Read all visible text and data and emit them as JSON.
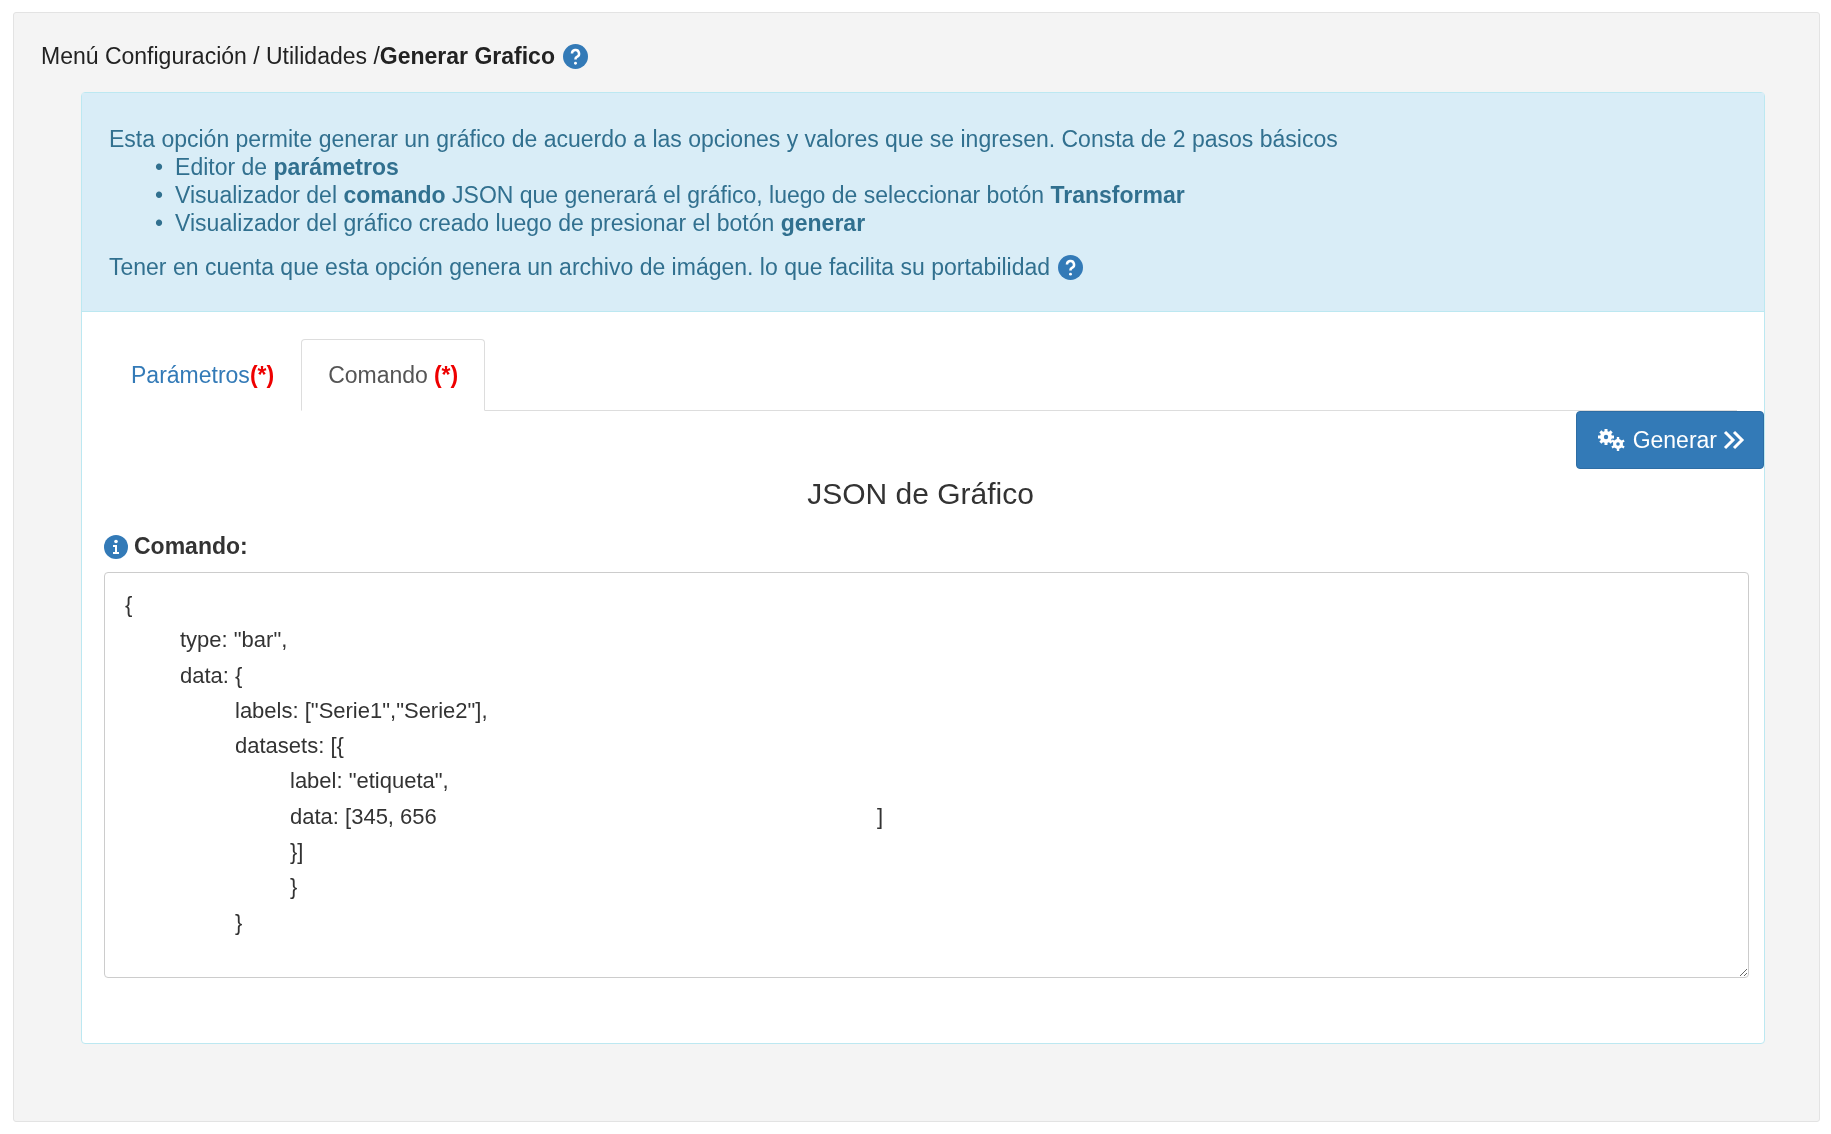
{
  "breadcrumb": {
    "text": "Menú Configuración / Utilidades /**Generar Grafico**"
  },
  "info": {
    "intro": "Esta opción permite generar un gráfico de acuerdo a las opciones y valores que se ingresen. Consta de 2 pasos básicos",
    "steps": [
      {
        "marker": "•",
        "text": "Editor de **parámetros**"
      },
      {
        "marker": "•",
        "text": "Visualizador del **comando** JSON que generará el gráfico, luego de seleccionar botón **Transformar**"
      },
      {
        "marker": "•",
        "text": "Visualizador del gráfico creado luego de presionar el botón **generar**"
      }
    ],
    "note": "Tener en cuenta que esta opción genera un archivo de imágen. lo que facilita su portabilidad"
  },
  "tabs": [
    {
      "label": "Parámetros",
      "required": "(*)",
      "selected": false
    },
    {
      "label": "Comando",
      "required": "(*)",
      "selected": true
    }
  ],
  "generate_button": {
    "label": "Generar"
  },
  "section_title": "JSON de Gráfico",
  "command": {
    "label": "Comando:",
    "value": "{\n\ttype: \"bar\",\n\tdata: {\n\t\tlabels: [\"Serie1\",\"Serie2\"],\n\t\tdatasets: [{\n\t\t\tlabel: \"etiqueta\",\n\t\t\tdata: [345, 656                                                                        ]\n\t\t\t}]\n\t\t\t}\n\t\t}"
  }
}
